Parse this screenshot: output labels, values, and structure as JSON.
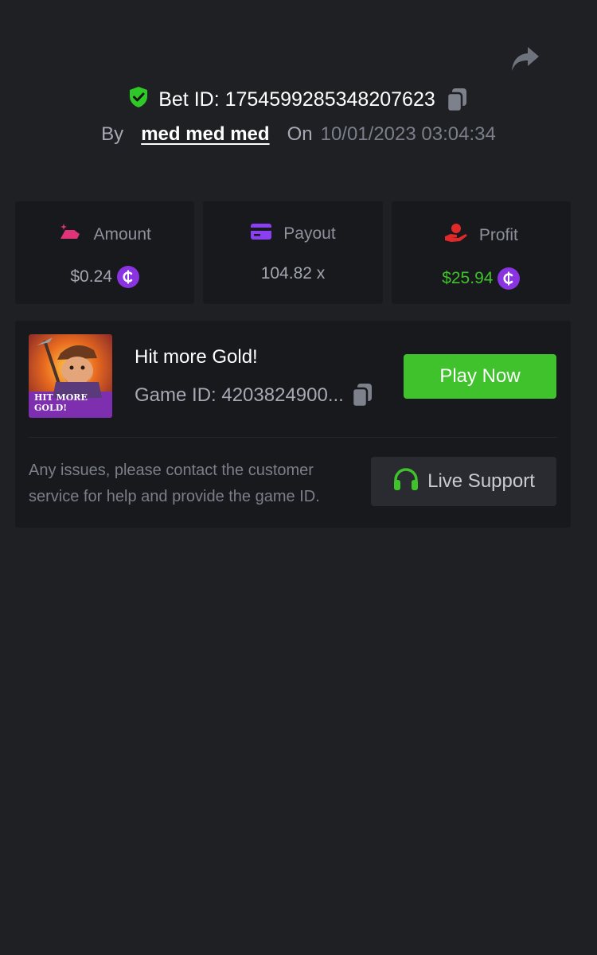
{
  "header": {
    "bet_id_label": "Bet ID: 1754599285348207623",
    "by_label": "By",
    "username": "med med med",
    "on_label": "On",
    "datetime": "10/01/2023 03:04:34"
  },
  "stats": [
    {
      "label": "Amount",
      "value": "$0.24",
      "icon": "gold-bars-icon",
      "icon_color": "#e0337a",
      "has_coin": true
    },
    {
      "label": "Payout",
      "value": "104.82 x",
      "icon": "credit-card-icon",
      "icon_color": "#8a3ff0",
      "has_coin": false
    },
    {
      "label": "Profit",
      "value": "$25.94",
      "icon": "hand-coin-icon",
      "icon_color": "#e02a2a",
      "has_coin": true
    }
  ],
  "game": {
    "title": "Hit more Gold!",
    "game_id_label": "Game ID: 4203824900...",
    "thumb_text_line1": "HIT MORE",
    "thumb_text_line2": "GOLD!",
    "play_label": "Play Now"
  },
  "support": {
    "message": "Any issues, please contact the customer service for help and provide the game ID.",
    "button_label": "Live Support"
  },
  "colors": {
    "background": "#1f2024",
    "card": "#18191d",
    "accent_green": "#3fc22b",
    "coin_purple": "#8a33e0"
  }
}
